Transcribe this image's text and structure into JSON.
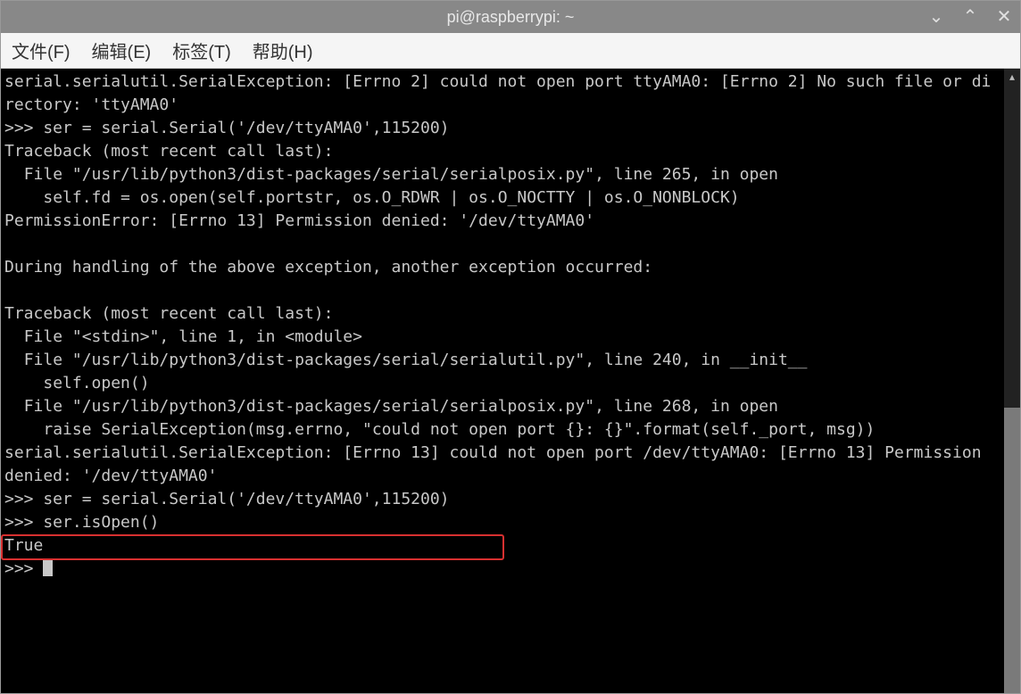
{
  "window": {
    "title": "pi@raspberrypi: ~"
  },
  "menu": {
    "file": "文件(F)",
    "edit": "编辑(E)",
    "tabs": "标签(T)",
    "help": "帮助(H)"
  },
  "terminal": {
    "content": "serial.serialutil.SerialException: [Errno 2] could not open port ttyAMA0: [Errno 2] No such file or directory: 'ttyAMA0'\n>>> ser = serial.Serial('/dev/ttyAMA0',115200)\nTraceback (most recent call last):\n  File \"/usr/lib/python3/dist-packages/serial/serialposix.py\", line 265, in open\n    self.fd = os.open(self.portstr, os.O_RDWR | os.O_NOCTTY | os.O_NONBLOCK)\nPermissionError: [Errno 13] Permission denied: '/dev/ttyAMA0'\n\nDuring handling of the above exception, another exception occurred:\n\nTraceback (most recent call last):\n  File \"<stdin>\", line 1, in <module>\n  File \"/usr/lib/python3/dist-packages/serial/serialutil.py\", line 240, in __init__\n    self.open()\n  File \"/usr/lib/python3/dist-packages/serial/serialposix.py\", line 268, in open\n    raise SerialException(msg.errno, \"could not open port {}: {}\".format(self._port, msg))\nserial.serialutil.SerialException: [Errno 13] could not open port /dev/ttyAMA0: [Errno 13] Permission denied: '/dev/ttyAMA0'\n>>> ser = serial.Serial('/dev/ttyAMA0',115200)\n>>> ser.isOpen()\nTrue\n>>> "
  }
}
